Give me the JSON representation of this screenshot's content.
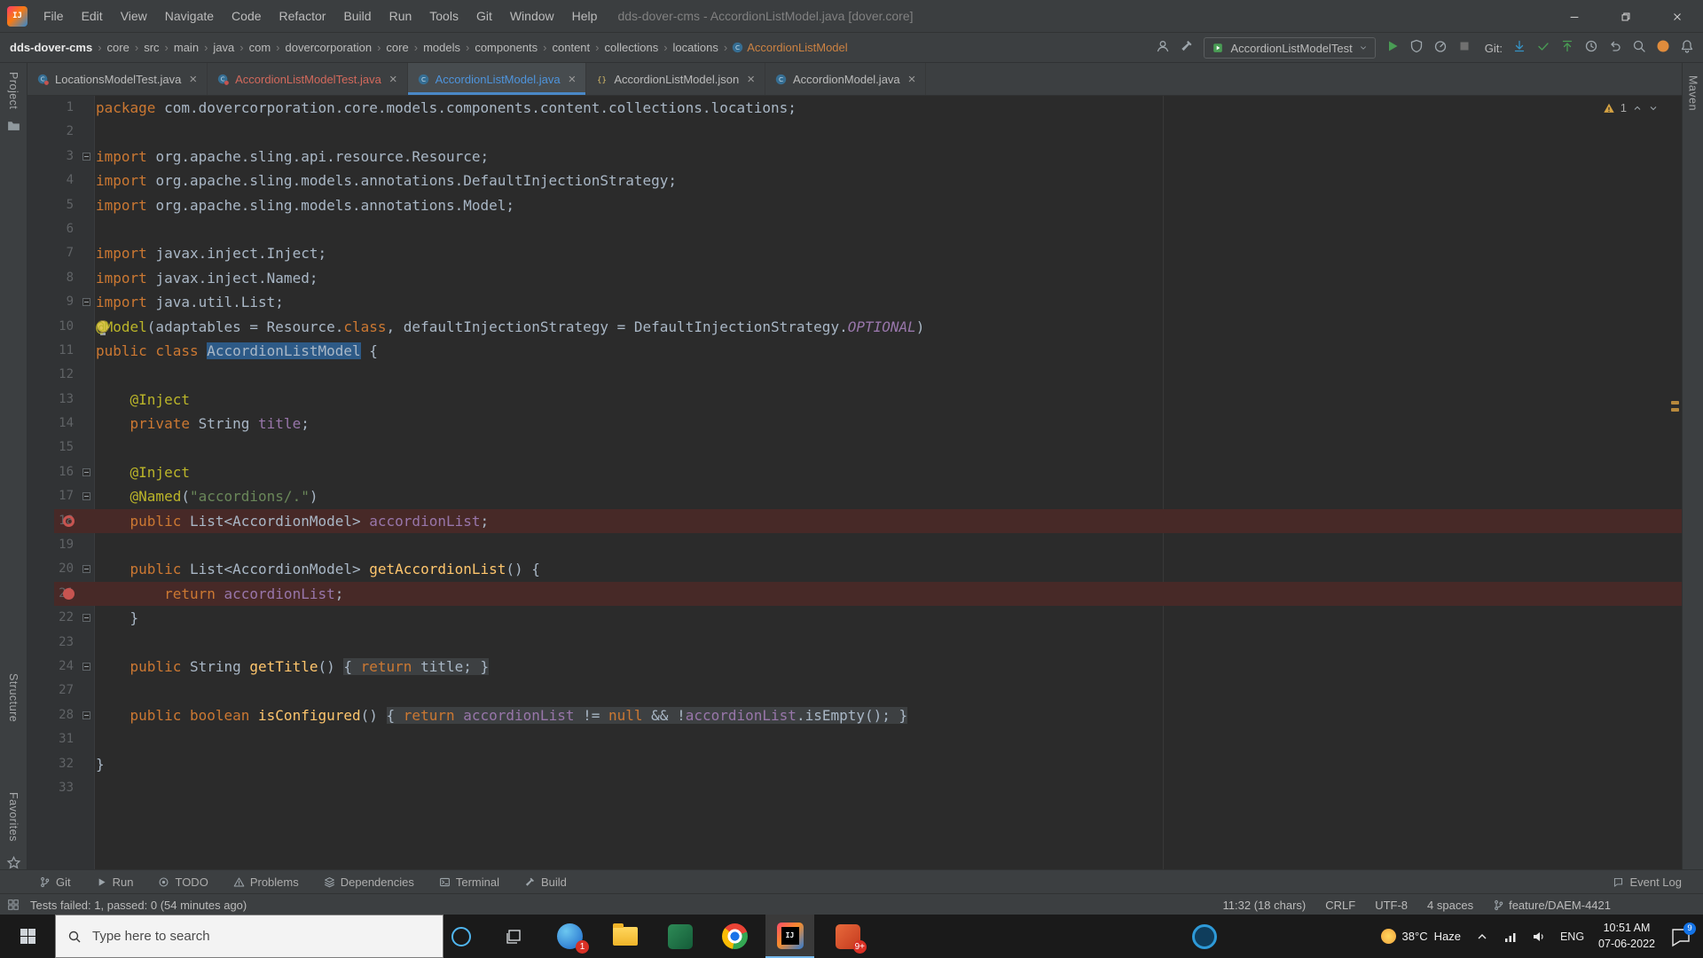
{
  "colors": {
    "accent_blue": "#4A88C7",
    "selection_blue": "#2d5a87",
    "breakpoint_line": "#472927",
    "breakpoint_red": "#c75450",
    "warning_yellow": "#d6a343",
    "run_green": "#499C54",
    "modified_tab_blue": "#4e94dc",
    "error_tab_red": "#d2695c",
    "keyword_orange": "#cc7832",
    "annotation_yellow": "#bbb529",
    "string_green": "#6a8759",
    "field_purple": "#9876aa",
    "method_yellow": "#ffc66d",
    "editor_bg": "#2b2b2b",
    "chrome_bg": "#3c3f41"
  },
  "titlebar": {
    "menus": [
      "File",
      "Edit",
      "View",
      "Navigate",
      "Code",
      "Refactor",
      "Build",
      "Run",
      "Tools",
      "Git",
      "Window",
      "Help"
    ],
    "title": "dds-dover-cms - AccordionListModel.java [dover.core]"
  },
  "navbar": {
    "breadcrumbs": [
      "dds-dover-cms",
      "core",
      "src",
      "main",
      "java",
      "com",
      "dovercorporation",
      "core",
      "models",
      "components",
      "content",
      "collections",
      "locations"
    ],
    "current_class": "AccordionListModel",
    "left_icons": [
      "user",
      "hammer"
    ],
    "run_config": "AccordionListModelTest",
    "run_icons": [
      "play",
      "coverage",
      "profiler",
      "stop"
    ],
    "git_label": "Git:",
    "vcs_icons": [
      "update",
      "commit",
      "push",
      "history",
      "rollback"
    ],
    "far_icons": [
      "search",
      "plugin",
      "bell"
    ]
  },
  "tabs": [
    {
      "label": "LocationsModelTest.java",
      "kind": "test",
      "state": "normal"
    },
    {
      "label": "AccordionListModelTest.java",
      "kind": "test",
      "state": "error"
    },
    {
      "label": "AccordionListModel.java",
      "kind": "class",
      "state": "selected"
    },
    {
      "label": "AccordionListModel.json",
      "kind": "json",
      "state": "normal"
    },
    {
      "label": "AccordionModel.java",
      "kind": "class",
      "state": "normal"
    }
  ],
  "stripes": {
    "project": "Project",
    "structure": "Structure",
    "favorites": "Favorites",
    "maven": "Maven"
  },
  "editor": {
    "warning_count": "1",
    "lines": [
      {
        "n": "1",
        "seg": [
          [
            "k",
            "package "
          ],
          [
            "t",
            "com.dovercorporation.core.models.components.content.collections.locations;"
          ]
        ]
      },
      {
        "n": "2",
        "seg": []
      },
      {
        "n": "3",
        "g": "fold",
        "seg": [
          [
            "k",
            "import "
          ],
          [
            "t",
            "org.apache.sling.api.resource.Resource;"
          ]
        ]
      },
      {
        "n": "4",
        "seg": [
          [
            "k",
            "import "
          ],
          [
            "t",
            "org.apache.sling.models.annotations.DefaultInjectionStrategy;"
          ]
        ]
      },
      {
        "n": "5",
        "seg": [
          [
            "k",
            "import "
          ],
          [
            "t",
            "org.apache.sling.models.annotations.Model;"
          ]
        ]
      },
      {
        "n": "6",
        "seg": []
      },
      {
        "n": "7",
        "seg": [
          [
            "k",
            "import "
          ],
          [
            "t",
            "javax.inject.Inject;"
          ]
        ]
      },
      {
        "n": "8",
        "seg": [
          [
            "k",
            "import "
          ],
          [
            "t",
            "javax.inject.Named;"
          ]
        ]
      },
      {
        "n": "9",
        "g": "fold",
        "seg": [
          [
            "k",
            "import "
          ],
          [
            "t",
            "java.util.List;"
          ]
        ]
      },
      {
        "n": "10",
        "g": "bulb",
        "seg": [
          [
            "a",
            "@Model"
          ],
          [
            "t",
            "(adaptables = Resource."
          ],
          [
            "k",
            "class"
          ],
          [
            "t",
            ", defaultInjectionStrategy = DefaultInjectionStrategy."
          ],
          [
            "c",
            "OPTIONAL"
          ],
          [
            "t",
            ")"
          ]
        ]
      },
      {
        "n": "11",
        "seg": [
          [
            "k",
            "public class "
          ],
          [
            "sel",
            "AccordionListModel"
          ],
          [
            "t",
            " {"
          ]
        ]
      },
      {
        "n": "12",
        "seg": []
      },
      {
        "n": "13",
        "seg": [
          [
            "t",
            "    "
          ],
          [
            "a",
            "@Inject"
          ]
        ]
      },
      {
        "n": "14",
        "seg": [
          [
            "t",
            "    "
          ],
          [
            "k",
            "private "
          ],
          [
            "t",
            "String "
          ],
          [
            "f",
            "title"
          ],
          [
            "t",
            ";"
          ]
        ]
      },
      {
        "n": "15",
        "seg": []
      },
      {
        "n": "16",
        "g": "fold",
        "seg": [
          [
            "t",
            "    "
          ],
          [
            "a",
            "@Inject"
          ]
        ]
      },
      {
        "n": "17",
        "g": "fold",
        "seg": [
          [
            "t",
            "    "
          ],
          [
            "a",
            "@Named"
          ],
          [
            "t",
            "("
          ],
          [
            "s",
            "\"accordions/.\""
          ],
          [
            "t",
            ")"
          ]
        ]
      },
      {
        "n": "18",
        "bg": "bp",
        "g": "bpring",
        "seg": [
          [
            "t",
            "    "
          ],
          [
            "k",
            "public "
          ],
          [
            "t",
            "List<AccordionModel> "
          ],
          [
            "f",
            "accordionList"
          ],
          [
            "t",
            ";"
          ]
        ]
      },
      {
        "n": "19",
        "seg": []
      },
      {
        "n": "20",
        "g": "fold",
        "seg": [
          [
            "t",
            "    "
          ],
          [
            "k",
            "public "
          ],
          [
            "t",
            "List<AccordionModel> "
          ],
          [
            "m",
            "getAccordionList"
          ],
          [
            "t",
            "() {"
          ]
        ]
      },
      {
        "n": "21",
        "bg": "bp",
        "g": "bp",
        "seg": [
          [
            "t",
            "        "
          ],
          [
            "k",
            "return "
          ],
          [
            "f",
            "accordionList"
          ],
          [
            "t",
            ";"
          ]
        ]
      },
      {
        "n": "22",
        "g": "foldend",
        "seg": [
          [
            "t",
            "    }"
          ]
        ]
      },
      {
        "n": "23",
        "seg": []
      },
      {
        "n": "24",
        "g": "fold",
        "seg": [
          [
            "t",
            "    "
          ],
          [
            "k",
            "public "
          ],
          [
            "t",
            "String "
          ],
          [
            "m",
            "getTitle"
          ],
          [
            "t",
            "() "
          ],
          [
            "t fd",
            "{ "
          ],
          [
            "k fd",
            "return "
          ],
          [
            "t fd",
            "title; }"
          ]
        ]
      },
      {
        "n": "27",
        "seg": []
      },
      {
        "n": "28",
        "g": "fold",
        "seg": [
          [
            "t",
            "    "
          ],
          [
            "k",
            "public boolean "
          ],
          [
            "m",
            "isConfigured"
          ],
          [
            "t",
            "() "
          ],
          [
            "t fd",
            "{ "
          ],
          [
            "k fd",
            "return "
          ],
          [
            "f fd",
            "accordionList"
          ],
          [
            "t fd",
            " != "
          ],
          [
            "k fd",
            "null"
          ],
          [
            "t fd",
            " && !"
          ],
          [
            "f fd",
            "accordionList"
          ],
          [
            "t fd",
            ".isEmpty(); }"
          ]
        ]
      },
      {
        "n": "31",
        "seg": []
      },
      {
        "n": "32",
        "seg": [
          [
            "t",
            "}"
          ]
        ]
      },
      {
        "n": "33",
        "seg": []
      }
    ]
  },
  "toolbar_bottom": {
    "left": [
      {
        "icon": "git",
        "label": "Git"
      },
      {
        "icon": "run",
        "label": "Run"
      },
      {
        "icon": "todo",
        "label": "TODO"
      },
      {
        "icon": "problems",
        "label": "Problems"
      },
      {
        "icon": "deps",
        "label": "Dependencies"
      },
      {
        "icon": "terminal",
        "label": "Terminal"
      },
      {
        "icon": "build",
        "label": "Build"
      }
    ],
    "event_log": "Event Log"
  },
  "statusbar": {
    "message": "Tests failed: 1, passed: 0 (54 minutes ago)",
    "items": [
      "11:32 (18 chars)",
      "CRLF",
      "UTF-8",
      "4 spaces"
    ],
    "branch": "feature/DAEM-4421"
  },
  "taskbar": {
    "search_placeholder": "Type here to search",
    "apps": [
      {
        "name": "browser-app",
        "type": "circle-blue",
        "badge": "1"
      },
      {
        "name": "file-explorer",
        "type": "folder",
        "badge": ""
      },
      {
        "name": "green-app",
        "type": "square-green",
        "badge": ""
      },
      {
        "name": "chrome",
        "type": "chrome",
        "badge": ""
      },
      {
        "name": "intellij",
        "type": "intellij",
        "badge": "",
        "active": true
      },
      {
        "name": "orange-app",
        "type": "square-orange",
        "badge": "9+"
      }
    ],
    "pinned_app": {
      "name": "blue-ring-app",
      "type": "ring-blue"
    },
    "weather_temp": "38°C",
    "weather_desc": "Haze",
    "language": "ENG",
    "time": "10:51 AM",
    "date": "07-06-2022",
    "notification_count": "9"
  }
}
